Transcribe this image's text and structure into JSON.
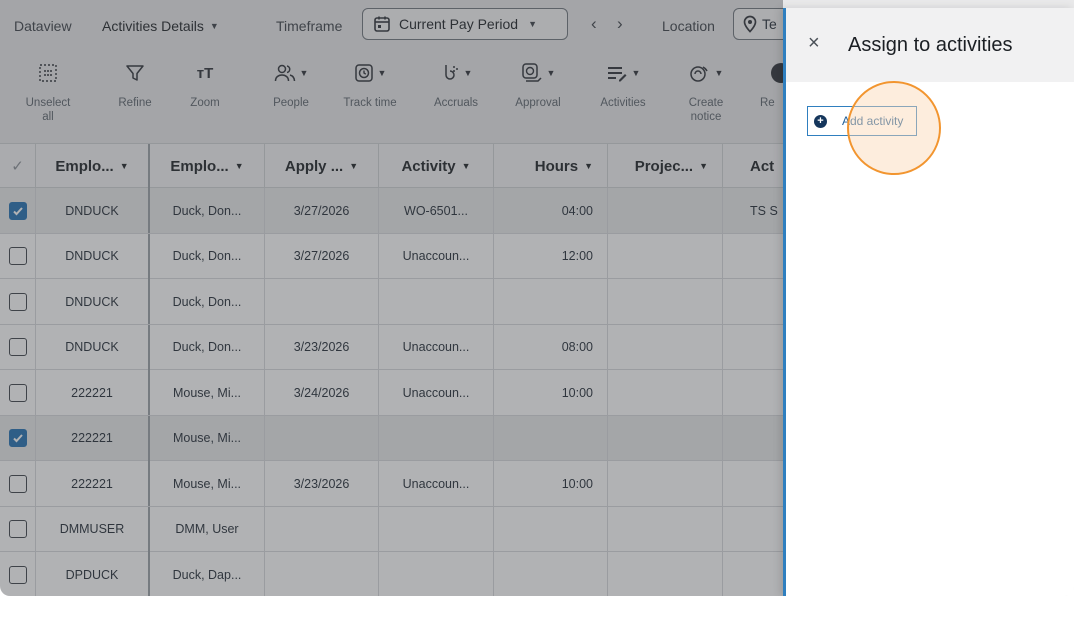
{
  "toolbar": {
    "dataview_label": "Dataview",
    "view_name": "Activities Details",
    "timeframe_label": "Timeframe",
    "timeframe_value": "Current Pay Period",
    "prev_symbol": "‹",
    "next_symbol": "›",
    "location_label": "Location",
    "location_value": "Te"
  },
  "tools": [
    {
      "label": "Unselect all",
      "icon": "unselect-icon"
    },
    {
      "label": "Refine",
      "icon": "filter-icon"
    },
    {
      "label": "Zoom",
      "icon": "text-zoom-icon"
    },
    {
      "label": "People",
      "icon": "people-icon"
    },
    {
      "label": "Track time",
      "icon": "timer-icon"
    },
    {
      "label": "Accruals",
      "icon": "accruals-icon"
    },
    {
      "label": "Approval",
      "icon": "approval-icon"
    },
    {
      "label": "Activities",
      "icon": "activities-icon"
    },
    {
      "label": "Create notice",
      "icon": "notice-icon"
    },
    {
      "label": "Re",
      "icon": "more-icon"
    }
  ],
  "columns": [
    "Emplo...",
    "Emplo...",
    "Apply ...",
    "Activity",
    "Hours",
    "Projec...",
    "Act"
  ],
  "rows": [
    {
      "checked": true,
      "id": "DNDUCK",
      "name": "Duck, Don...",
      "date": "3/27/2026",
      "activity": "WO-6501...",
      "hours": "04:00",
      "project": "",
      "act": "TS S"
    },
    {
      "checked": false,
      "id": "DNDUCK",
      "name": "Duck, Don...",
      "date": "3/27/2026",
      "activity": "Unaccoun...",
      "hours": "12:00",
      "project": "",
      "act": ""
    },
    {
      "checked": false,
      "id": "DNDUCK",
      "name": "Duck, Don...",
      "date": "",
      "activity": "",
      "hours": "",
      "project": "",
      "act": ""
    },
    {
      "checked": false,
      "id": "DNDUCK",
      "name": "Duck, Don...",
      "date": "3/23/2026",
      "activity": "Unaccoun...",
      "hours": "08:00",
      "project": "",
      "act": ""
    },
    {
      "checked": false,
      "id": "222221",
      "name": "Mouse, Mi...",
      "date": "3/24/2026",
      "activity": "Unaccoun...",
      "hours": "10:00",
      "project": "",
      "act": ""
    },
    {
      "checked": true,
      "id": "222221",
      "name": "Mouse, Mi...",
      "date": "",
      "activity": "",
      "hours": "",
      "project": "",
      "act": ""
    },
    {
      "checked": false,
      "id": "222221",
      "name": "Mouse, Mi...",
      "date": "3/23/2026",
      "activity": "Unaccoun...",
      "hours": "10:00",
      "project": "",
      "act": ""
    },
    {
      "checked": false,
      "id": "DMMUSER",
      "name": "DMM, User",
      "date": "",
      "activity": "",
      "hours": "",
      "project": "",
      "act": ""
    },
    {
      "checked": false,
      "id": "DPDUCK",
      "name": "Duck, Dap...",
      "date": "",
      "activity": "",
      "hours": "",
      "project": "",
      "act": ""
    }
  ],
  "panel": {
    "title": "Assign to activities",
    "close_symbol": "×",
    "add_label": "Add activity"
  },
  "colors": {
    "accent": "#1f6fb2",
    "highlight": "#f2952f"
  }
}
